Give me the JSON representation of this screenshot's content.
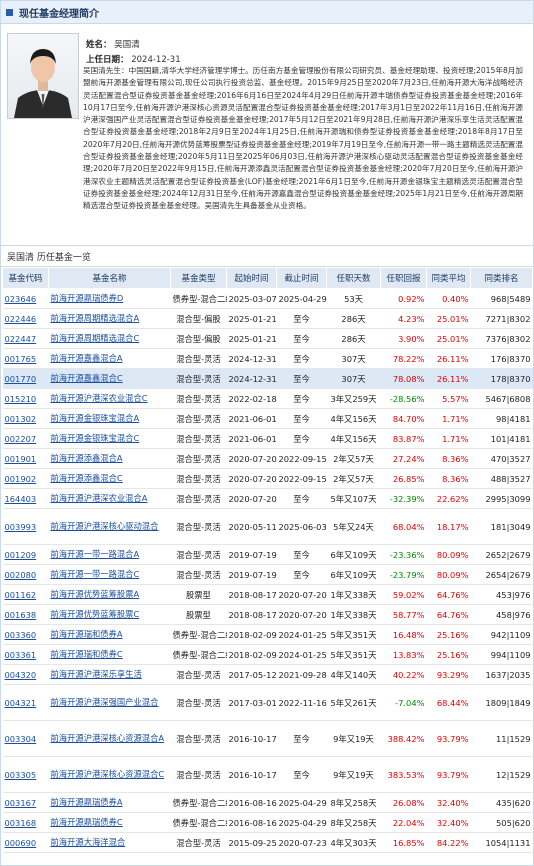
{
  "section_title": "现任基金经理简介",
  "manager": {
    "name_label": "姓名：",
    "name": "吴国清",
    "start_label": "上任日期：",
    "start_date": "2024-12-31",
    "bio": "吴国清先生：中国国籍,清华大学经济管理学博士。历任南方基金管理股份有限公司研究员、基金经理助理、投资经理;2015年8月加盟前海开源基金管理有限公司,现任公司执行投资总监、基金经理。2015年9月25日至2020年7月23日,任前海开源大海洋战略经济灵活配置混合型证券投资基金基金经理;2016年6月16日至2024年4月29日任前海开源丰瑞债券型证券投资基金基金经理;2016年10月17日至今,任前海开源沪港深核心资源灵活配置混合型证券投资基金基金经理;2017年3月1日至2022年11月16日,任前海开源沪港深强国产业灵活配置混合型证券投资基金基金经理;2017年5月12日至2021年9月28日,任前海开源沪港深乐享生活灵活配置混合型证券投资基金基金经理;2018年2月9日至2024年1月25日,任前海开源瑞和债券型证券投资基金基金经理;2018年8月17日至2020年7月20日,任前海开源优势蓝筹股票型证券投资基金基金经理;2019年7月19日至今,任前海开源一带一路主题精选灵活配置混合型证券投资基金基金经理;2020年5月11日至2025年06月03日,任前海开源沪港深核心驱动灵活配置混合型证券投资基金基金经理;2020年7月20日至2022年9月15日,任前海开源添鑫灵活配置混合型证券投资基金基金经理;2020年7月20日至今,任前海开源沪港深农业主题精选灵活配置混合型证券投资基金(LOF)基金经理;2021年6月1日至今,任前海开源金银珠宝主题精选灵活配置混合型证券投资基金基金经理;2024年12月31日至今,任前海开源嘉鑫混合型证券投资基金基金经理;2025年1月21日至今,任前海开源周期精选混合型证券投资基金基金经理。吴国清先生具备基金从业资格。"
  },
  "list_title": "吴国清 历任基金一览",
  "columns": [
    "基金代码",
    "基金名称",
    "基金类型",
    "起始时间",
    "截止时间",
    "任职天数",
    "任职回报",
    "同类平均",
    "同类排名"
  ],
  "funds": [
    {
      "code": "023646",
      "name": "前海开源鼎瑞债券D",
      "type": "债券型-混合二级",
      "start": "2025-03-07",
      "end": "2025-04-29",
      "days": "53天",
      "ret": "0.92%",
      "avg": "0.40%",
      "rank": "968|5489"
    },
    {
      "code": "022446",
      "name": "前海开源周期精选混合A",
      "type": "混合型-偏股",
      "start": "2025-01-21",
      "end": "至今",
      "days": "286天",
      "ret": "4.23%",
      "avg": "25.01%",
      "rank": "7271|8302"
    },
    {
      "code": "022447",
      "name": "前海开源周期精选混合C",
      "type": "混合型-偏股",
      "start": "2025-01-21",
      "end": "至今",
      "days": "286天",
      "ret": "3.90%",
      "avg": "25.01%",
      "rank": "7376|8302"
    },
    {
      "code": "001765",
      "name": "前海开源嘉鑫混合A",
      "type": "混合型-灵活",
      "start": "2024-12-31",
      "end": "至今",
      "days": "307天",
      "ret": "78.22%",
      "avg": "26.11%",
      "rank": "176|8370"
    },
    {
      "code": "001770",
      "name": "前海开源嘉鑫混合C",
      "type": "混合型-灵活",
      "start": "2024-12-31",
      "end": "至今",
      "days": "307天",
      "ret": "78.08%",
      "avg": "26.11%",
      "rank": "178|8370",
      "hl": true
    },
    {
      "code": "015210",
      "name": "前海开源沪港深农业混合C",
      "type": "混合型-灵活",
      "start": "2022-02-18",
      "end": "至今",
      "days": "3年又259天",
      "ret": "-28.56%",
      "avg": "5.57%",
      "rank": "5467|6808"
    },
    {
      "code": "001302",
      "name": "前海开源金银珠宝混合A",
      "type": "混合型-灵活",
      "start": "2021-06-01",
      "end": "至今",
      "days": "4年又156天",
      "ret": "84.70%",
      "avg": "1.71%",
      "rank": "98|4181"
    },
    {
      "code": "002207",
      "name": "前海开源金银珠宝混合C",
      "type": "混合型-灵活",
      "start": "2021-06-01",
      "end": "至今",
      "days": "4年又156天",
      "ret": "83.87%",
      "avg": "1.71%",
      "rank": "101|4181"
    },
    {
      "code": "001901",
      "name": "前海开源添鑫混合A",
      "type": "混合型-灵活",
      "start": "2020-07-20",
      "end": "2022-09-15",
      "days": "2年又57天",
      "ret": "27.24%",
      "avg": "8.36%",
      "rank": "470|3527"
    },
    {
      "code": "001902",
      "name": "前海开源添鑫混合C",
      "type": "混合型-灵活",
      "start": "2020-07-20",
      "end": "2022-09-15",
      "days": "2年又57天",
      "ret": "26.85%",
      "avg": "8.36%",
      "rank": "488|3527"
    },
    {
      "code": "164403",
      "name": "前海开源沪港深农业混合A",
      "type": "混合型-灵活",
      "start": "2020-07-20",
      "end": "至今",
      "days": "5年又107天",
      "ret": "-32.39%",
      "avg": "22.62%",
      "rank": "2995|3099"
    },
    {
      "code": "003993",
      "name": "前海开源沪港深核心驱动混合",
      "type": "混合型-灵活",
      "start": "2020-05-11",
      "end": "2025-06-03",
      "days": "5年又24天",
      "ret": "68.04%",
      "avg": "18.17%",
      "rank": "181|3049",
      "tall": true
    },
    {
      "code": "001209",
      "name": "前海开源一带一路混合A",
      "type": "混合型-灵活",
      "start": "2019-07-19",
      "end": "至今",
      "days": "6年又109天",
      "ret": "-23.36%",
      "avg": "80.09%",
      "rank": "2652|2679"
    },
    {
      "code": "002080",
      "name": "前海开源一带一路混合C",
      "type": "混合型-灵活",
      "start": "2019-07-19",
      "end": "至今",
      "days": "6年又109天",
      "ret": "-23.79%",
      "avg": "80.09%",
      "rank": "2654|2679"
    },
    {
      "code": "001162",
      "name": "前海开源优势蓝筹股票A",
      "type": "股票型",
      "start": "2018-08-17",
      "end": "2020-07-20",
      "days": "1年又338天",
      "ret": "59.02%",
      "avg": "64.76%",
      "rank": "453|976"
    },
    {
      "code": "001638",
      "name": "前海开源优势蓝筹股票C",
      "type": "股票型",
      "start": "2018-08-17",
      "end": "2020-07-20",
      "days": "1年又338天",
      "ret": "58.77%",
      "avg": "64.76%",
      "rank": "458|976"
    },
    {
      "code": "003360",
      "name": "前海开源瑞和债券A",
      "type": "债券型-混合二级",
      "start": "2018-02-09",
      "end": "2024-01-25",
      "days": "5年又351天",
      "ret": "16.48%",
      "avg": "25.16%",
      "rank": "942|1109"
    },
    {
      "code": "003361",
      "name": "前海开源瑞和债券C",
      "type": "债券型-混合二级",
      "start": "2018-02-09",
      "end": "2024-01-25",
      "days": "5年又351天",
      "ret": "13.83%",
      "avg": "25.16%",
      "rank": "994|1109"
    },
    {
      "code": "004320",
      "name": "前海开源沪港深乐享生活",
      "type": "混合型-灵活",
      "start": "2017-05-12",
      "end": "2021-09-28",
      "days": "4年又140天",
      "ret": "40.22%",
      "avg": "93.29%",
      "rank": "1637|2035"
    },
    {
      "code": "004321",
      "name": "前海开源沪港深强国产业混合",
      "type": "混合型-灵活",
      "start": "2017-03-01",
      "end": "2022-11-16",
      "days": "5年又261天",
      "ret": "-7.04%",
      "avg": "68.44%",
      "rank": "1809|1849",
      "tall": true
    },
    {
      "code": "003304",
      "name": "前海开源沪港深核心资源混合A",
      "type": "混合型-灵活",
      "start": "2016-10-17",
      "end": "至今",
      "days": "9年又19天",
      "ret": "388.42%",
      "avg": "93.79%",
      "rank": "11|1529",
      "tall": true
    },
    {
      "code": "003305",
      "name": "前海开源沪港深核心资源混合C",
      "type": "混合型-灵活",
      "start": "2016-10-17",
      "end": "至今",
      "days": "9年又19天",
      "ret": "383.53%",
      "avg": "93.79%",
      "rank": "12|1529",
      "tall": true
    },
    {
      "code": "003167",
      "name": "前海开源鼎瑞债券A",
      "type": "债券型-混合二级",
      "start": "2016-08-16",
      "end": "2025-04-29",
      "days": "8年又258天",
      "ret": "26.08%",
      "avg": "32.40%",
      "rank": "435|620"
    },
    {
      "code": "003168",
      "name": "前海开源鼎瑞债券C",
      "type": "债券型-混合二级",
      "start": "2016-08-16",
      "end": "2025-04-29",
      "days": "8年又258天",
      "ret": "22.04%",
      "avg": "32.40%",
      "rank": "505|620"
    },
    {
      "code": "000690",
      "name": "前海开源大海洋混合",
      "type": "混合型-灵活",
      "start": "2015-09-25",
      "end": "2020-07-23",
      "days": "4年又303天",
      "ret": "16.85%",
      "avg": "84.22%",
      "rank": "1054|1131"
    }
  ]
}
